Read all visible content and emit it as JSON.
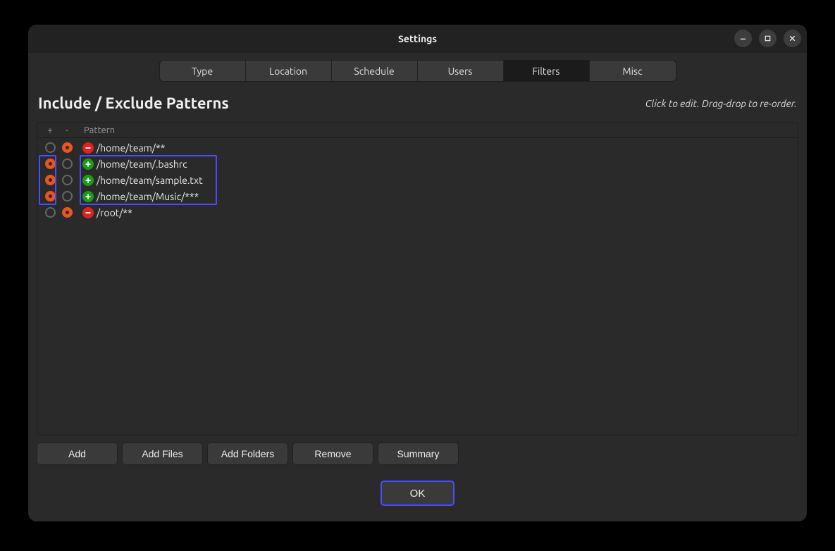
{
  "titlebar": {
    "title": "Settings"
  },
  "tabs": [
    {
      "label": "Type",
      "active": false
    },
    {
      "label": "Location",
      "active": false
    },
    {
      "label": "Schedule",
      "active": false
    },
    {
      "label": "Users",
      "active": false
    },
    {
      "label": "Filters",
      "active": true
    },
    {
      "label": "Misc",
      "active": false
    }
  ],
  "page": {
    "title": "Include / Exclude Patterns",
    "hint": "Click to edit. Drag-drop to re-order."
  },
  "columns": {
    "plus": "+",
    "minus": "-",
    "pattern": "Pattern"
  },
  "rows": [
    {
      "plus": false,
      "minus": true,
      "type": "exclude",
      "pattern": "/home/team/**"
    },
    {
      "plus": true,
      "minus": false,
      "type": "include",
      "pattern": "/home/team/.bashrc"
    },
    {
      "plus": true,
      "minus": false,
      "type": "include",
      "pattern": "/home/team/sample.txt"
    },
    {
      "plus": true,
      "minus": false,
      "type": "include",
      "pattern": "/home/team/Music/***"
    },
    {
      "plus": false,
      "minus": true,
      "type": "exclude",
      "pattern": "/root/**"
    }
  ],
  "buttons": {
    "add": "Add",
    "add_files": "Add Files",
    "add_folders": "Add Folders",
    "remove": "Remove",
    "summary": "Summary",
    "ok": "OK"
  }
}
